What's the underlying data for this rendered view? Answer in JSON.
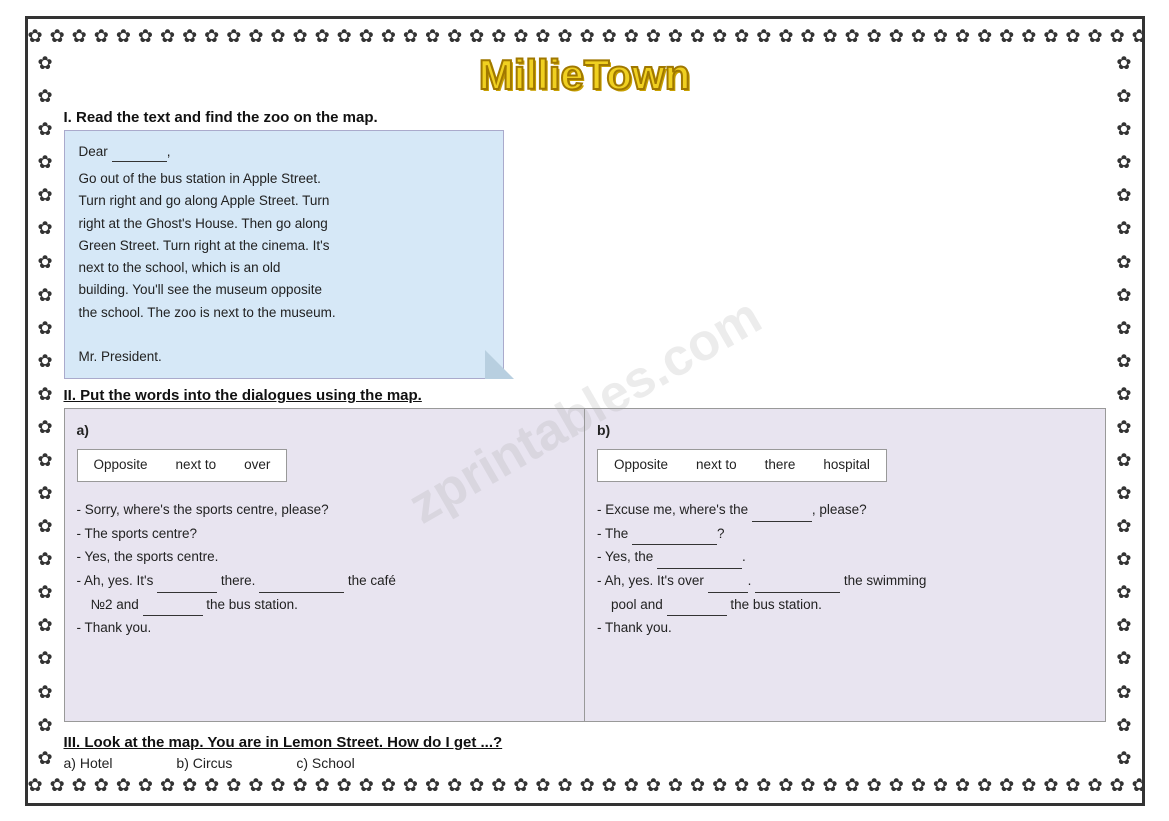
{
  "title": "MillieTown",
  "border_char": "✿",
  "section1": {
    "heading": "I. Read the text and find the zoo on the map.",
    "letter": {
      "greeting": "Dear",
      "body_lines": [
        "Go out of the bus station in Apple Street.",
        "Turn right and go along Apple Street. Turn",
        "right at the Ghost's House. Then go along",
        "Green Street. Turn right at the cinema. It's",
        "next to the school, which is an old",
        "building. You'll see the museum opposite",
        "the school. The zoo is next to the museum.",
        "",
        "Mr. President."
      ]
    }
  },
  "section2": {
    "heading": "II. Put the words into the dialogues using the map.",
    "panel_a": {
      "label": "a)",
      "words": [
        "Opposite",
        "next to",
        "over"
      ],
      "lines": [
        "- Sorry, where's the sports centre, please?",
        "- The sports centre?",
        "- Yes, the sports centre.",
        "- Ah, yes. It's ______ there. _________ the café",
        "  №2 and _______ the bus station.",
        "- Thank you."
      ]
    },
    "panel_b": {
      "label": "b)",
      "words": [
        "Opposite",
        "next to",
        "there",
        "hospital"
      ],
      "lines": [
        "- Excuse me, where's the ________, please?",
        "- The _________?",
        "- Yes, the _________.",
        "- Ah, yes. It's over _______. __________ the swimming",
        "  pool and _______ the bus station.",
        "- Thank you."
      ]
    }
  },
  "section3": {
    "heading": "III. Look at the map. You are in Lemon Street. How do I get ...?",
    "options": [
      {
        "label": "a) Hotel"
      },
      {
        "label": "b) Circus"
      },
      {
        "label": "c) School"
      }
    ]
  },
  "watermark": "zprintables.com"
}
